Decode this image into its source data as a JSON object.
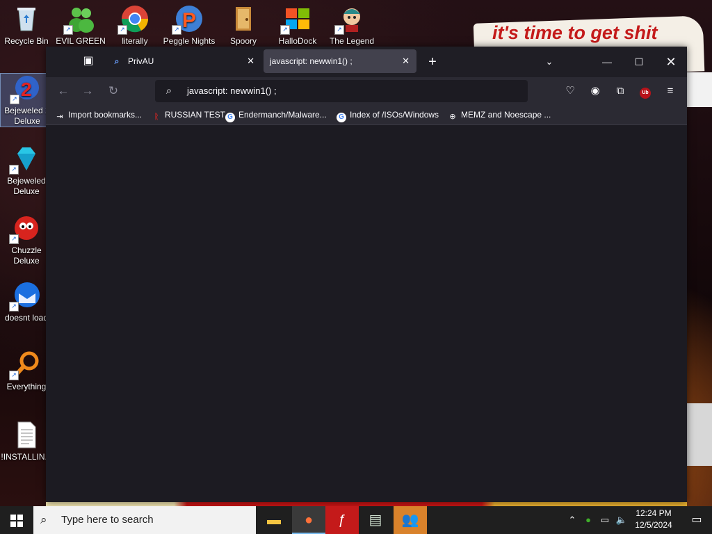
{
  "desktop": {
    "wallpaper_text": "it's time to get shit",
    "icons": [
      {
        "label": "Recycle Bin",
        "glyph": "🗑"
      },
      {
        "label": "EVIL GREEN",
        "glyph": "👥"
      },
      {
        "label": "literally",
        "glyph": "◉"
      },
      {
        "label": "Peggle Nights",
        "glyph": "P"
      },
      {
        "label": "Spoory",
        "glyph": "🚪"
      },
      {
        "label": "HalloDock",
        "glyph": "⊞"
      },
      {
        "label": "The Legend",
        "glyph": "☺"
      },
      {
        "label": "Bejeweled 2 Deluxe",
        "glyph": "2"
      },
      {
        "label": "Bejeweled Deluxe",
        "glyph": "◆"
      },
      {
        "label": "Chuzzle Deluxe",
        "glyph": "●"
      },
      {
        "label": "doesnt load",
        "glyph": "✉"
      },
      {
        "label": "Everything",
        "glyph": "◯"
      },
      {
        "label": "!INSTALLIN...",
        "glyph": "≣"
      }
    ]
  },
  "browser": {
    "tabs": [
      {
        "label": "PrivAU",
        "icon": "search-icon"
      },
      {
        "label": "javascript: newwin1() ;"
      }
    ],
    "url": "javascript: newwin1() ;",
    "bookmarks": [
      {
        "label": "Import bookmarks...",
        "icon": "import-icon"
      },
      {
        "label": "RUSSIAN TEST",
        "icon": "r-icon"
      },
      {
        "label": "Endermanch/Malware...",
        "icon": "google-icon"
      },
      {
        "label": "Index of /ISOs/Windows",
        "icon": "google-icon"
      },
      {
        "label": "MEMZ and Noescape ...",
        "icon": "globe-icon"
      }
    ],
    "ublock_badge": "Ub"
  },
  "taskbar": {
    "search_placeholder": "Type here to search",
    "time": "12:24 PM",
    "date": "12/5/2024"
  }
}
